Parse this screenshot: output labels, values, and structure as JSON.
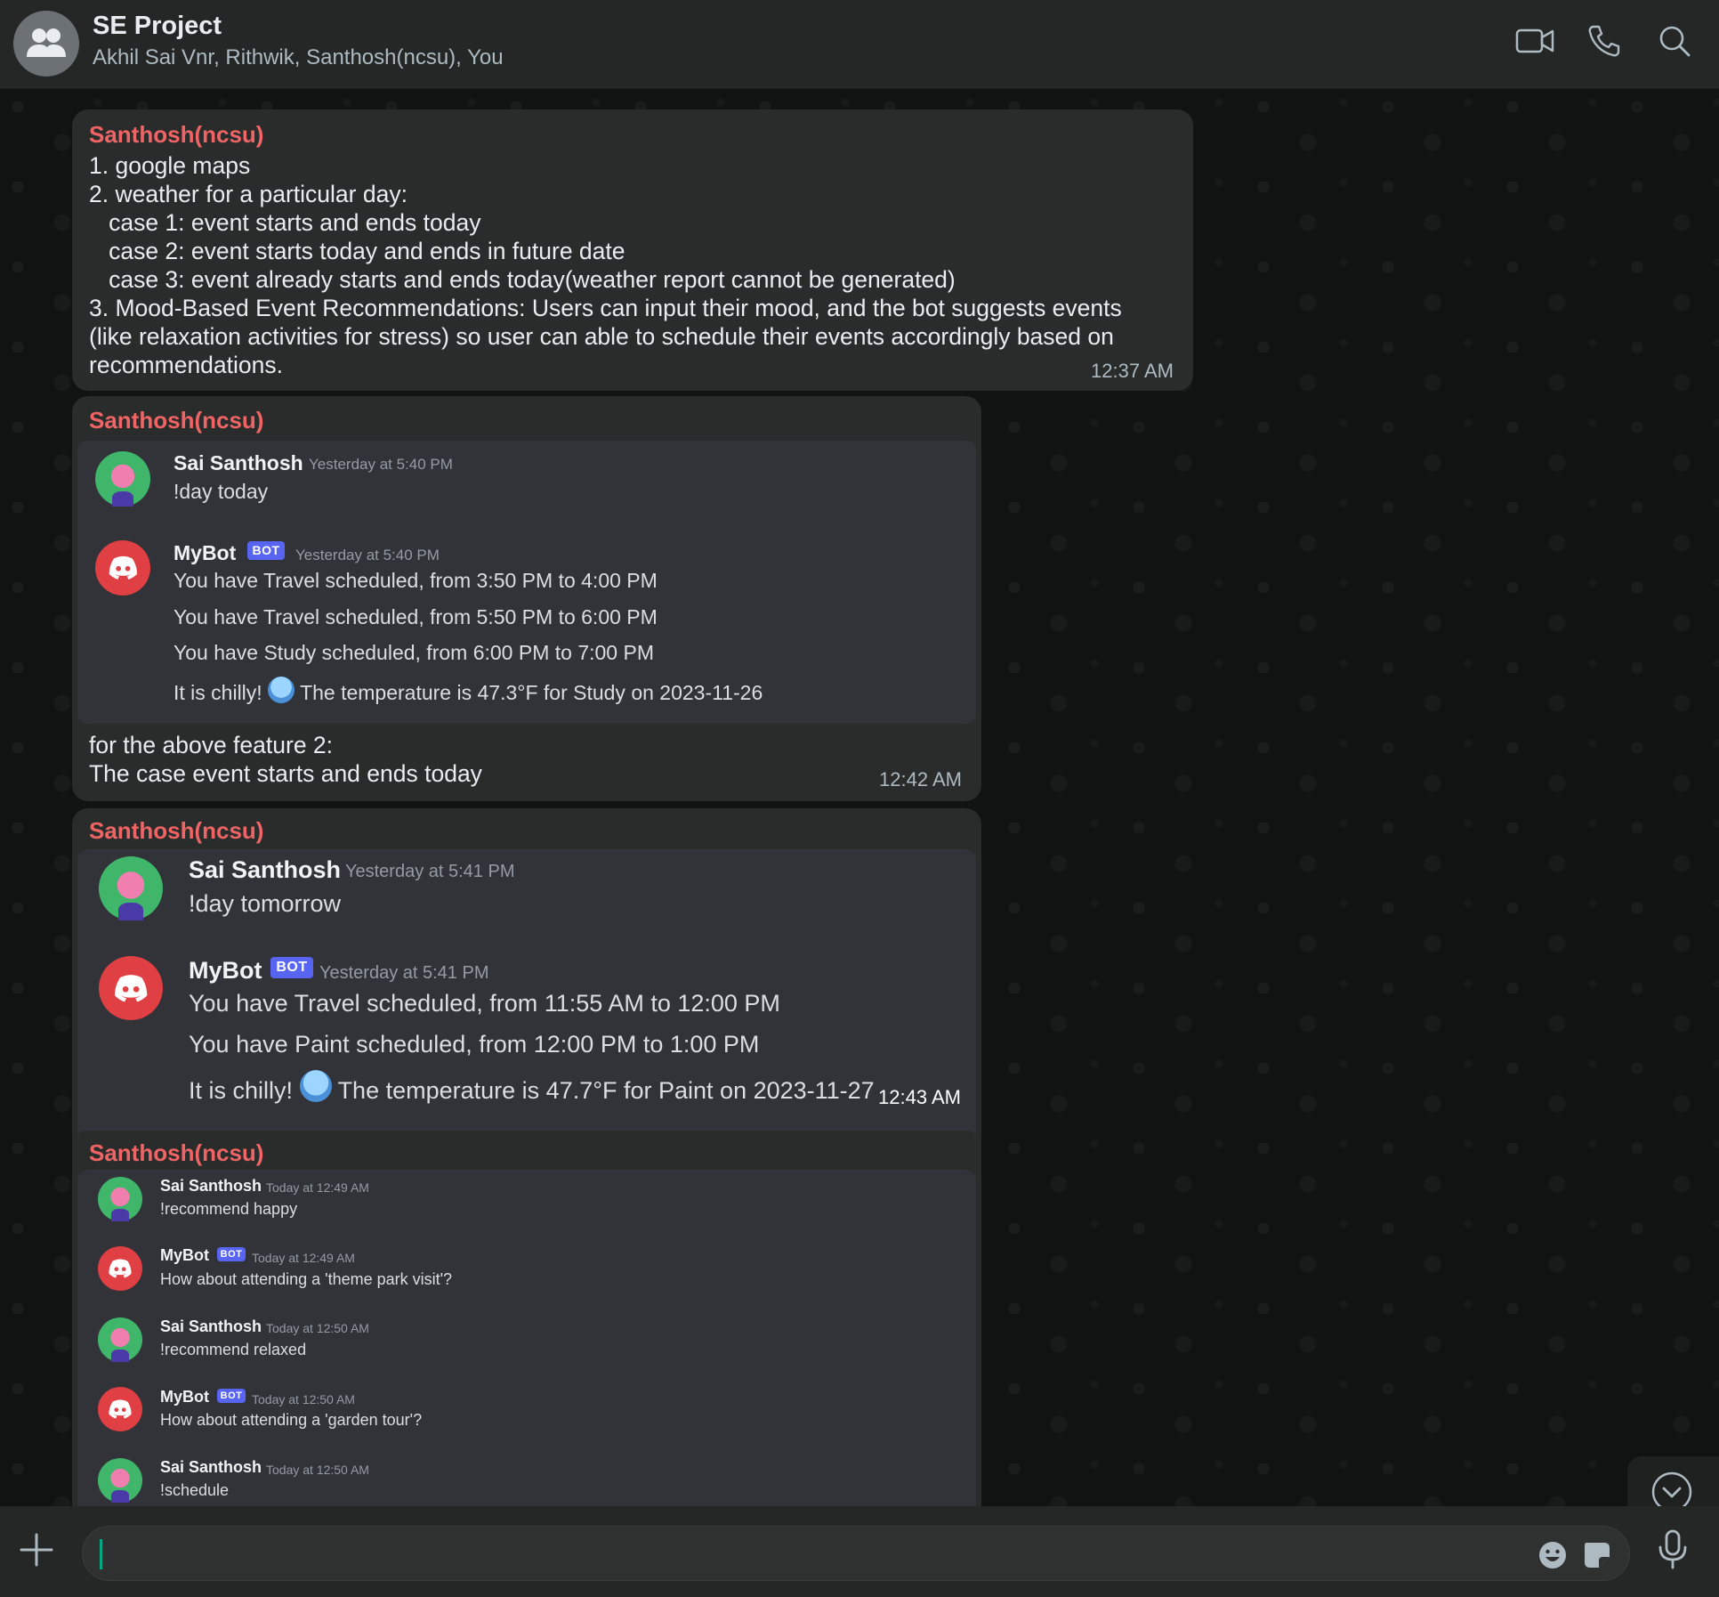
{
  "header": {
    "title": "SE Project",
    "members": "Akhil Sai Vnr, Rithwik, Santhosh(ncsu), You",
    "icons": [
      "group-avatar-icon",
      "video-call-icon",
      "phone-icon",
      "search-icon"
    ]
  },
  "messages": [
    {
      "sender": "Santhosh(ncsu)",
      "lines": [
        "1. google maps",
        "2. weather for a particular day:",
        "   case 1: event starts and ends today",
        "   case 2: event starts today and ends in future date",
        "   case 3: event already starts and ends today(weather report cannot be generated)",
        "3. Mood-Based Event Recommendations: Users can input their mood, and the bot suggests events",
        "(like relaxation activities for stress) so user can able to schedule their events accordingly based on",
        "recommendations."
      ],
      "time": "12:37 AM"
    },
    {
      "sender": "Santhosh(ncsu)",
      "screenshot": {
        "entries": [
          {
            "name": "Sai Santhosh",
            "stamp": "Yesterday at 5:40 PM",
            "lines": [
              "!day today"
            ]
          },
          {
            "name": "MyBot",
            "badge": "BOT",
            "stamp": "Yesterday at 5:40 PM",
            "lines": [
              "You have Travel scheduled, from 3:50 PM to 4:00 PM",
              "You have Travel scheduled, from 5:50 PM to 6:00 PM",
              "You have Study scheduled, from 6:00 PM to 7:00 PM"
            ],
            "chilly_prefix": "It is chilly!",
            "chilly_suffix": "The temperature is 47.3°F for Study on 2023-11-26"
          }
        ]
      },
      "caption": [
        "for the above feature 2:",
        "The case event starts and ends today"
      ],
      "time": "12:42 AM"
    },
    {
      "sender": "Santhosh(ncsu)",
      "screenshot": {
        "entries": [
          {
            "name": "Sai Santhosh",
            "stamp": "Yesterday at 5:41 PM",
            "lines": [
              "!day tomorrow"
            ]
          },
          {
            "name": "MyBot",
            "badge": "BOT",
            "stamp": "Yesterday at 5:41 PM",
            "lines": [
              "You have Travel scheduled, from 11:55 AM to 12:00 PM",
              "You have Paint scheduled, from 12:00 PM to 1:00 PM"
            ],
            "chilly_prefix": "It is chilly!",
            "chilly_suffix": "The temperature is 47.7°F for Paint on 2023-11-27"
          }
        ]
      },
      "time": "12:43 AM"
    },
    {
      "sender": "Santhosh(ncsu)",
      "screenshot": {
        "entries": [
          {
            "name": "Sai Santhosh",
            "stamp": "Today at 12:49 AM",
            "lines": [
              "!recommend happy"
            ]
          },
          {
            "name": "MyBot",
            "badge": "BOT",
            "stamp": "Today at 12:49 AM",
            "lines": [
              "How about attending a 'theme park visit'?"
            ]
          },
          {
            "name": "Sai Santhosh",
            "stamp": "Today at 12:50 AM",
            "lines": [
              "!recommend relaxed"
            ]
          },
          {
            "name": "MyBot",
            "badge": "BOT",
            "stamp": "Today at 12:50 AM",
            "lines": [
              "How about attending a 'garden tour'?"
            ]
          },
          {
            "name": "Sai Santhosh",
            "stamp": "Today at 12:50 AM",
            "lines": [
              "!schedule"
            ]
          }
        ]
      }
    }
  ],
  "composer": {
    "value": "",
    "placeholder": "",
    "icons": [
      "plus-icon",
      "emoji-icon",
      "sticker-icon",
      "microphone-icon"
    ]
  },
  "colors": {
    "sender": "#ef6464",
    "accent": "#00a884",
    "bubble": "#2a2c2c",
    "discord_bg": "#313338",
    "bot_badge": "#5865f2"
  }
}
